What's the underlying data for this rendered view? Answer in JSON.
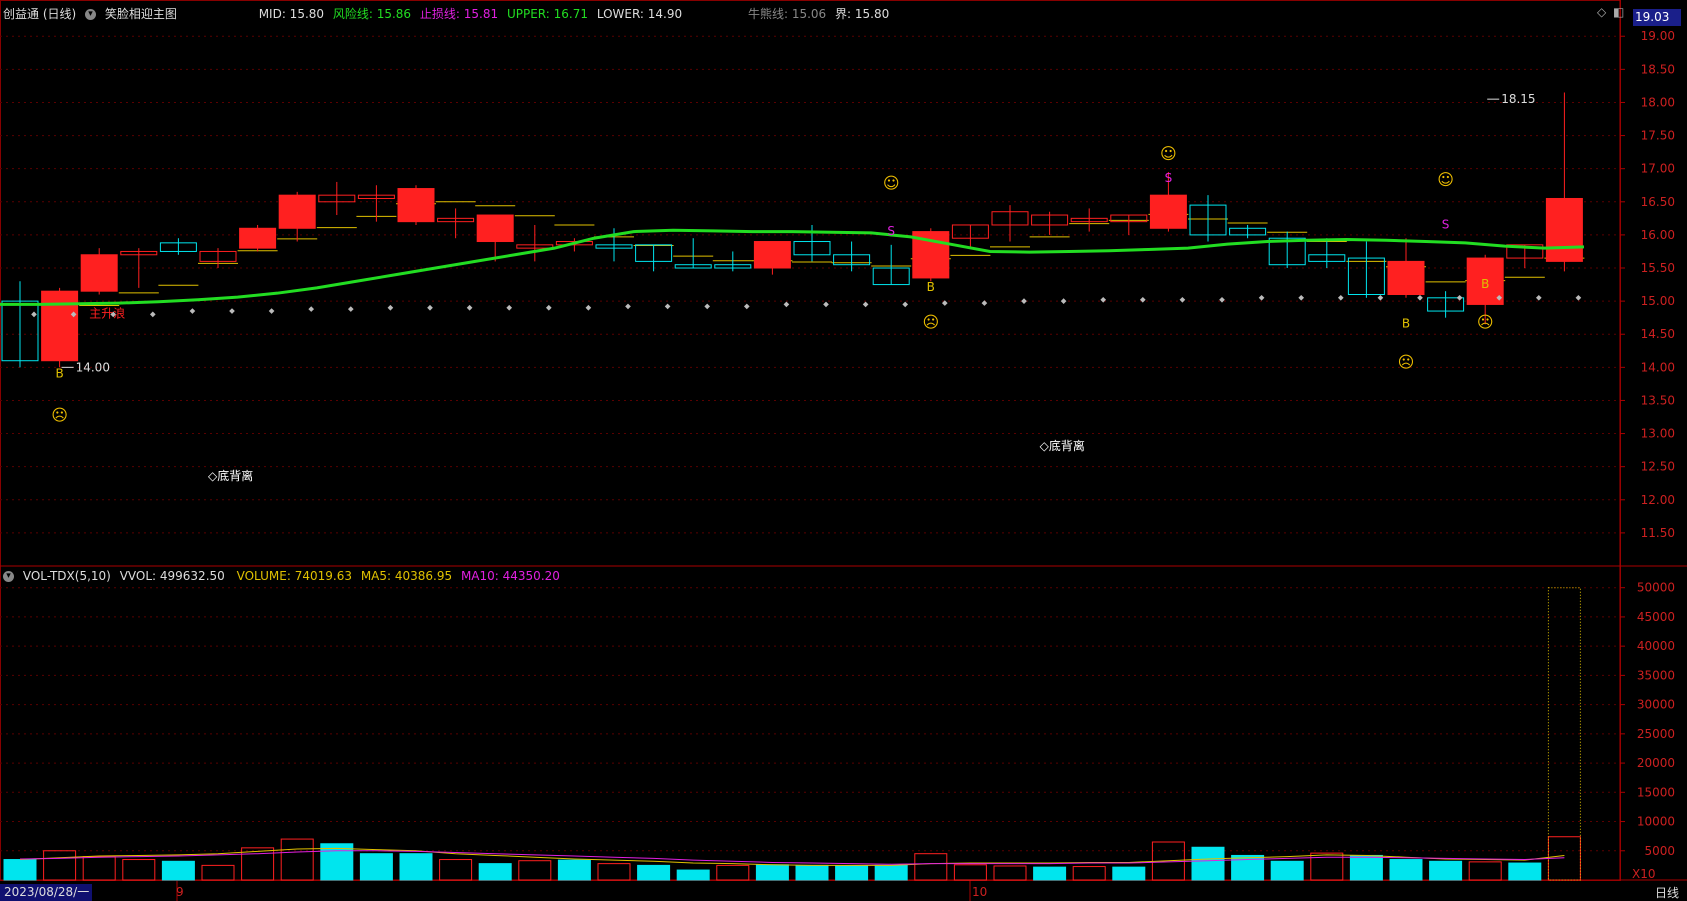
{
  "header": {
    "stock_name": "创益通 (日线)",
    "indicator_name": "笑脸相迎主图",
    "mid": "MID: 15.80",
    "risk": "风险线: 15.86",
    "stoploss": "止损线: 15.81",
    "upper": "UPPER: 16.71",
    "lower": "LOWER: 14.90",
    "bear": "牛熊线: 15.06",
    "bound": "界: 15.80"
  },
  "price_badge": "19.03",
  "vol_header": {
    "name": "VOL-TDX(5,10)",
    "vvol": "VVOL: 499632.50",
    "volume": "VOLUME: 74019.63",
    "ma5": "MA5: 40386.95",
    "ma10": "MA10: 44350.20"
  },
  "footer": {
    "date": "2023/08/28/一",
    "month9": "9",
    "month10": "10",
    "period": "日线",
    "x10": "X10"
  },
  "colors": {
    "up": "#ff2020",
    "down": "#00e5ee",
    "green_line": "#22dd22",
    "yellow": "#e0c000",
    "magenta": "#e020e0",
    "grid": "#5a0000"
  },
  "chart_data": [
    {
      "type": "candlestick",
      "title": "创益通 (日线)",
      "ylim": [
        11.0,
        19.2
      ],
      "y_ticks": [
        11.5,
        12.0,
        12.5,
        13.0,
        13.5,
        14.0,
        14.5,
        15.0,
        15.5,
        16.0,
        16.5,
        17.0,
        17.5,
        18.0,
        18.5,
        19.0
      ],
      "candles": [
        {
          "o": 15.0,
          "h": 15.3,
          "l": 14.0,
          "c": 14.1
        },
        {
          "o": 14.1,
          "h": 15.2,
          "l": 14.0,
          "c": 15.15
        },
        {
          "o": 15.15,
          "h": 15.8,
          "l": 15.1,
          "c": 15.7
        },
        {
          "o": 15.7,
          "h": 15.8,
          "l": 15.2,
          "c": 15.75
        },
        {
          "o": 15.88,
          "h": 15.95,
          "l": 15.7,
          "c": 15.75
        },
        {
          "o": 15.6,
          "h": 15.8,
          "l": 15.5,
          "c": 15.75
        },
        {
          "o": 15.8,
          "h": 16.15,
          "l": 15.75,
          "c": 16.1
        },
        {
          "o": 16.1,
          "h": 16.65,
          "l": 15.9,
          "c": 16.6
        },
        {
          "o": 16.5,
          "h": 16.8,
          "l": 16.3,
          "c": 16.6
        },
        {
          "o": 16.55,
          "h": 16.75,
          "l": 16.2,
          "c": 16.6
        },
        {
          "o": 16.2,
          "h": 16.75,
          "l": 16.15,
          "c": 16.7
        },
        {
          "o": 16.2,
          "h": 16.4,
          "l": 15.95,
          "c": 16.25
        },
        {
          "o": 15.9,
          "h": 16.3,
          "l": 15.6,
          "c": 16.3
        },
        {
          "o": 15.8,
          "h": 16.15,
          "l": 15.6,
          "c": 15.85
        },
        {
          "o": 15.85,
          "h": 15.95,
          "l": 15.75,
          "c": 15.9
        },
        {
          "o": 15.85,
          "h": 16.1,
          "l": 15.6,
          "c": 15.8
        },
        {
          "o": 15.85,
          "h": 15.85,
          "l": 15.45,
          "c": 15.6
        },
        {
          "o": 15.55,
          "h": 15.95,
          "l": 15.5,
          "c": 15.5
        },
        {
          "o": 15.55,
          "h": 15.75,
          "l": 15.45,
          "c": 15.5
        },
        {
          "o": 15.5,
          "h": 15.9,
          "l": 15.4,
          "c": 15.9
        },
        {
          "o": 15.9,
          "h": 16.15,
          "l": 15.6,
          "c": 15.7
        },
        {
          "o": 15.7,
          "h": 15.9,
          "l": 15.45,
          "c": 15.55
        },
        {
          "o": 15.5,
          "h": 15.85,
          "l": 15.25,
          "c": 15.25
        },
        {
          "o": 15.35,
          "h": 16.1,
          "l": 15.3,
          "c": 16.05
        },
        {
          "o": 15.95,
          "h": 16.15,
          "l": 15.8,
          "c": 16.15
        },
        {
          "o": 16.15,
          "h": 16.45,
          "l": 15.9,
          "c": 16.35
        },
        {
          "o": 16.15,
          "h": 16.35,
          "l": 16.0,
          "c": 16.3
        },
        {
          "o": 16.2,
          "h": 16.4,
          "l": 16.05,
          "c": 16.25
        },
        {
          "o": 16.2,
          "h": 16.3,
          "l": 16.0,
          "c": 16.3
        },
        {
          "o": 16.1,
          "h": 16.95,
          "l": 16.05,
          "c": 16.6
        },
        {
          "o": 16.45,
          "h": 16.6,
          "l": 15.9,
          "c": 16.0
        },
        {
          "o": 16.1,
          "h": 16.15,
          "l": 15.95,
          "c": 16.0
        },
        {
          "o": 15.95,
          "h": 16.05,
          "l": 15.5,
          "c": 15.55
        },
        {
          "o": 15.7,
          "h": 15.95,
          "l": 15.5,
          "c": 15.6
        },
        {
          "o": 15.65,
          "h": 15.9,
          "l": 15.05,
          "c": 15.1
        },
        {
          "o": 15.1,
          "h": 15.95,
          "l": 15.05,
          "c": 15.6
        },
        {
          "o": 15.05,
          "h": 15.15,
          "l": 14.75,
          "c": 14.85
        },
        {
          "o": 14.95,
          "h": 15.7,
          "l": 14.65,
          "c": 15.65
        },
        {
          "o": 15.65,
          "h": 15.85,
          "l": 15.5,
          "c": 15.85
        },
        {
          "o": 15.6,
          "h": 18.15,
          "l": 15.45,
          "c": 16.55
        }
      ],
      "green_line": [
        14.95,
        14.95,
        14.96,
        14.97,
        14.99,
        15.02,
        15.06,
        15.12,
        15.2,
        15.3,
        15.4,
        15.5,
        15.6,
        15.7,
        15.8,
        15.95,
        16.05,
        16.07,
        16.06,
        16.05,
        16.05,
        16.04,
        16.03,
        15.97,
        15.86,
        15.75,
        15.74,
        15.75,
        15.76,
        15.78,
        15.8,
        15.86,
        15.9,
        15.92,
        15.93,
        15.92,
        15.9,
        15.88,
        15.83,
        15.8,
        15.82
      ],
      "dots": [
        14.8,
        14.8,
        14.8,
        14.8,
        14.85,
        14.85,
        14.85,
        14.88,
        14.88,
        14.9,
        14.9,
        14.9,
        14.9,
        14.9,
        14.9,
        14.92,
        14.92,
        14.92,
        14.92,
        14.95,
        14.95,
        14.95,
        14.95,
        14.97,
        14.97,
        15.0,
        15.0,
        15.02,
        15.02,
        15.02,
        15.02,
        15.05,
        15.05,
        15.05,
        15.05,
        15.05,
        15.05,
        15.05,
        15.05,
        15.05
      ],
      "annotations": [
        {
          "i": 1,
          "price": 13.85,
          "text": "B",
          "color": "#e0c000"
        },
        {
          "i": 1,
          "price": 13.2,
          "text": "☹",
          "color": "#f0c000"
        },
        {
          "i": 2,
          "price": 14.75,
          "text": "主升浪",
          "color": "#ff2020"
        },
        {
          "i": 5,
          "price": 12.3,
          "text": "◇底背离",
          "color": "#ffffff"
        },
        {
          "i": 22,
          "price": 16.7,
          "text": "☺",
          "color": "#f0c000"
        },
        {
          "i": 22,
          "price": 16.0,
          "text": "S",
          "color": "#e020e0"
        },
        {
          "i": 23,
          "price": 15.15,
          "text": "B",
          "color": "#e0c000"
        },
        {
          "i": 23,
          "price": 14.6,
          "text": "☹",
          "color": "#f0c000"
        },
        {
          "i": 26,
          "price": 12.75,
          "text": "◇底背离",
          "color": "#ffffff"
        },
        {
          "i": 29,
          "price": 17.15,
          "text": "☺",
          "color": "#f0c000"
        },
        {
          "i": 29,
          "price": 16.8,
          "text": "S",
          "color": "#e020e0"
        },
        {
          "i": 35,
          "price": 14.6,
          "text": "B",
          "color": "#e0c000"
        },
        {
          "i": 35,
          "price": 14.0,
          "text": "☹",
          "color": "#f0c000"
        },
        {
          "i": 36,
          "price": 16.75,
          "text": "☺",
          "color": "#f0c000"
        },
        {
          "i": 36,
          "price": 16.1,
          "text": "S",
          "color": "#e020e0"
        },
        {
          "i": 37,
          "price": 15.2,
          "text": "B",
          "color": "#e0c000"
        },
        {
          "i": 37,
          "price": 14.6,
          "text": "☹",
          "color": "#f0c000"
        }
      ],
      "labels": [
        {
          "text": "14.00",
          "i": 1,
          "price": 14.0
        },
        {
          "text": "18.15",
          "i": 37,
          "price": 18.05
        }
      ]
    },
    {
      "type": "bar",
      "title": "VOL-TDX(5,10)",
      "ylim": [
        0,
        52000
      ],
      "y_ticks": [
        5000,
        10000,
        15000,
        20000,
        25000,
        30000,
        35000,
        40000,
        45000,
        50000
      ],
      "volumes": [
        3500,
        5000,
        4000,
        3500,
        3200,
        2500,
        5500,
        7000,
        6200,
        4500,
        4500,
        3500,
        2800,
        3300,
        3400,
        2800,
        2500,
        1700,
        2500,
        2600,
        2500,
        2400,
        2500,
        4500,
        2600,
        2400,
        2200,
        2300,
        2200,
        6500,
        5600,
        4200,
        3200,
        4600,
        4200,
        3500,
        3200,
        3100,
        2900,
        7400
      ],
      "up_flags": [
        0,
        1,
        1,
        1,
        0,
        1,
        1,
        1,
        0,
        0,
        0,
        1,
        0,
        1,
        0,
        1,
        0,
        0,
        1,
        0,
        0,
        0,
        0,
        1,
        1,
        1,
        0,
        1,
        0,
        1,
        0,
        0,
        0,
        1,
        0,
        0,
        0,
        1,
        0,
        1
      ],
      "ma_line": [
        3500,
        3800,
        4100,
        4200,
        4300,
        4500,
        4900,
        5300,
        5400,
        5200,
        5000,
        4500,
        4200,
        3900,
        3600,
        3400,
        3200,
        2900,
        2800,
        2600,
        2500,
        2500,
        2500,
        2800,
        2900,
        2900,
        2900,
        3000,
        3000,
        3300,
        3600,
        3800,
        4000,
        4300,
        4200,
        3900,
        3600,
        3500,
        3400,
        4200
      ],
      "ma10_line": [
        3600,
        3700,
        3900,
        4000,
        4100,
        4300,
        4500,
        4800,
        5000,
        5000,
        4900,
        4700,
        4500,
        4300,
        4100,
        3900,
        3700,
        3400,
        3200,
        3000,
        2900,
        2800,
        2700,
        2800,
        2800,
        2800,
        2800,
        2900,
        2900,
        3100,
        3300,
        3500,
        3700,
        3900,
        3900,
        3800,
        3700,
        3600,
        3500,
        3800
      ],
      "highlight_bar": {
        "i": 39,
        "value": 50000
      }
    }
  ]
}
